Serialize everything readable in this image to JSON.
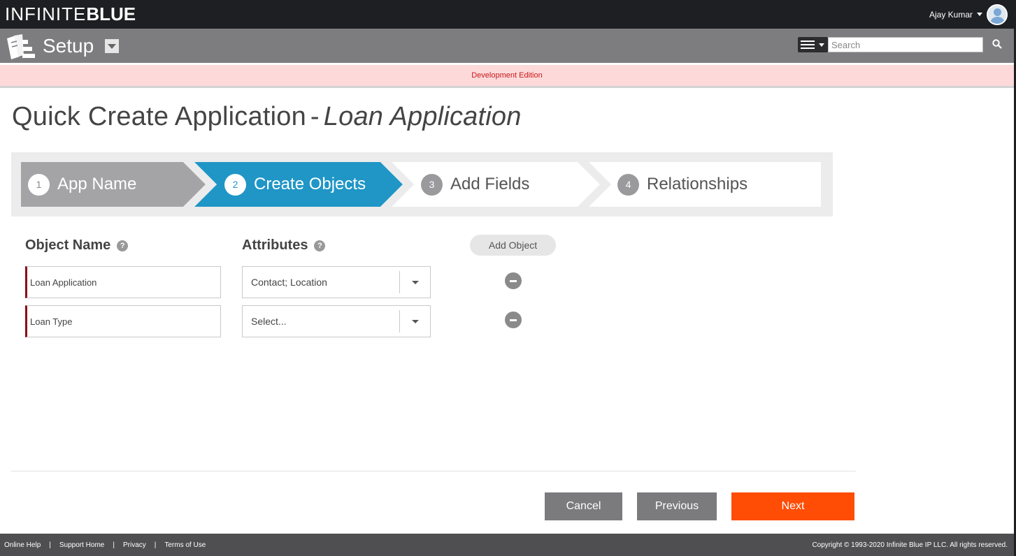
{
  "brand": {
    "part1": "INFINITE",
    "part2": "BLUE"
  },
  "user": {
    "name": "Ajay Kumar"
  },
  "setup": {
    "title": "Setup"
  },
  "search": {
    "placeholder": "Search"
  },
  "banner": {
    "text": "Development Edition"
  },
  "page": {
    "title_prefix": "Quick Create Application",
    "separator": "-",
    "title_app": "Loan Application"
  },
  "wizard": {
    "steps": [
      {
        "num": "1",
        "label": "App Name",
        "state": "completed"
      },
      {
        "num": "2",
        "label": "Create Objects",
        "state": "active"
      },
      {
        "num": "3",
        "label": "Add Fields",
        "state": "upcoming"
      },
      {
        "num": "4",
        "label": "Relationships",
        "state": "upcoming"
      }
    ]
  },
  "form": {
    "object_name_header": "Object Name",
    "attributes_header": "Attributes",
    "help_glyph": "?",
    "add_object_label": "Add Object",
    "rows": [
      {
        "object_name": "Loan Application",
        "attributes": "Contact; Location"
      },
      {
        "object_name": "Loan Type",
        "attributes": "Select..."
      }
    ]
  },
  "actions": {
    "cancel": "Cancel",
    "previous": "Previous",
    "next": "Next"
  },
  "footer": {
    "links": [
      "Online Help",
      "Support Home",
      "Privacy",
      "Terms of Use"
    ],
    "separator": "|",
    "copyright": "Copyright © 1993-2020 Infinite Blue IP LLC. All rights reserved."
  },
  "colors": {
    "active_step": "#1f96c6",
    "completed_step": "#a4a4a6",
    "next_button": "#ff4d05",
    "banner_text": "#c8181a",
    "required_marker": "#8b0a14"
  }
}
